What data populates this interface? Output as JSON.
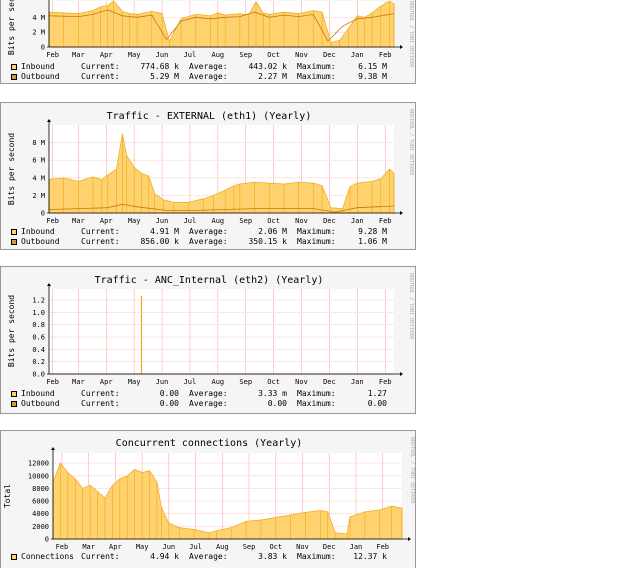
{
  "colors": {
    "inbound_fill": "#ffd270",
    "inbound_line": "#f0a818",
    "outbound_line": "#c87800",
    "outbound_sw": "#d89a28",
    "grid": "#ffaaaa",
    "bg": "#f5f5f5"
  },
  "watermark": "RRDTOOL / TOBI OETIKER",
  "chart_data": [
    {
      "type": "area",
      "title": "",
      "ylabel": "Bits per second",
      "yticks": [
        {
          "v": 0,
          "label": "0"
        },
        {
          "v": 2,
          "label": "2 M"
        },
        {
          "v": 4,
          "label": "4 M"
        }
      ],
      "ylim": [
        0,
        6.2
      ],
      "x_categories": [
        "Feb",
        "Mar",
        "Apr",
        "May",
        "Jun",
        "Jul",
        "Aug",
        "Sep",
        "Oct",
        "Nov",
        "Dec",
        "Jan",
        "Feb"
      ],
      "x_positions": [
        0.25,
        2,
        3.9,
        5.8,
        7.7,
        9.6,
        11.5,
        13.4,
        15.3,
        17.2,
        19.1,
        21,
        22.9
      ],
      "xrange": [
        0,
        23.5
      ],
      "x_unit": "month index from start of period",
      "series": [
        {
          "name": "Inbound",
          "kind": "area",
          "points": [
            [
              0,
              4.7
            ],
            [
              1,
              4.6
            ],
            [
              2,
              4.5
            ],
            [
              3,
              4.9
            ],
            [
              3.5,
              5.4
            ],
            [
              4,
              5.6
            ],
            [
              4.4,
              6.2
            ],
            [
              5,
              4.8
            ],
            [
              5.5,
              4.5
            ],
            [
              6,
              4.4
            ],
            [
              7,
              4.8
            ],
            [
              7.7,
              4.5
            ],
            [
              8.2,
              0.8
            ],
            [
              9,
              3.8
            ],
            [
              10,
              4.4
            ],
            [
              11,
              4.2
            ],
            [
              11.5,
              4.6
            ],
            [
              12,
              4.3
            ],
            [
              13,
              4.5
            ],
            [
              13.6,
              4.3
            ],
            [
              14.1,
              6.1
            ],
            [
              14.6,
              4.6
            ],
            [
              15,
              4.4
            ],
            [
              16,
              4.7
            ],
            [
              17,
              4.5
            ],
            [
              18,
              4.9
            ],
            [
              18.6,
              4.7
            ],
            [
              19.2,
              0.6
            ],
            [
              19.8,
              0.9
            ],
            [
              20.4,
              2.5
            ],
            [
              21,
              4.2
            ],
            [
              21.5,
              4.0
            ],
            [
              22,
              4.6
            ],
            [
              22.6,
              5.5
            ],
            [
              23.2,
              6.2
            ],
            [
              23.5,
              5.8
            ]
          ]
        },
        {
          "name": "Outbound",
          "kind": "line",
          "points": [
            [
              0,
              4.2
            ],
            [
              2,
              4.1
            ],
            [
              3,
              4.4
            ],
            [
              4,
              5.0
            ],
            [
              5,
              4.2
            ],
            [
              6,
              4.0
            ],
            [
              7,
              4.3
            ],
            [
              8,
              1.0
            ],
            [
              9,
              3.5
            ],
            [
              10,
              4.0
            ],
            [
              11,
              3.8
            ],
            [
              12,
              4.0
            ],
            [
              13,
              4.1
            ],
            [
              14,
              4.7
            ],
            [
              15,
              4.0
            ],
            [
              16,
              4.3
            ],
            [
              17,
              4.1
            ],
            [
              18,
              4.4
            ],
            [
              19,
              0.8
            ],
            [
              20,
              2.8
            ],
            [
              21,
              3.8
            ],
            [
              22,
              4.0
            ],
            [
              23.5,
              4.5
            ]
          ]
        }
      ],
      "legend": [
        {
          "name": "Inbound",
          "current": "774.68 k",
          "average": "443.02 k",
          "maximum": "6.15 M"
        },
        {
          "name": "Outbound",
          "current": "5.29 M",
          "average": "2.27 M",
          "maximum": "9.38 M"
        }
      ]
    },
    {
      "type": "area",
      "title": "Traffic - EXTERNAL (eth1) (Yearly)",
      "ylabel": "Bits per second",
      "yticks": [
        {
          "v": 0,
          "label": "0"
        },
        {
          "v": 2,
          "label": "2 M"
        },
        {
          "v": 4,
          "label": "4 M"
        },
        {
          "v": 6,
          "label": "6 M"
        },
        {
          "v": 8,
          "label": "8 M"
        }
      ],
      "ylim": [
        0,
        10
      ],
      "x_categories": [
        "Feb",
        "Mar",
        "Apr",
        "May",
        "Jun",
        "Jul",
        "Aug",
        "Sep",
        "Oct",
        "Nov",
        "Dec",
        "Jan",
        "Feb"
      ],
      "x_positions": [
        0.25,
        2,
        3.9,
        5.8,
        7.7,
        9.6,
        11.5,
        13.4,
        15.3,
        17.2,
        19.1,
        21,
        22.9
      ],
      "xrange": [
        0,
        23.5
      ],
      "x_unit": "month index from start of period",
      "series": [
        {
          "name": "Inbound",
          "kind": "area",
          "points": [
            [
              0,
              3.8
            ],
            [
              1,
              4.0
            ],
            [
              2,
              3.6
            ],
            [
              3,
              4.1
            ],
            [
              3.6,
              3.8
            ],
            [
              4,
              4.3
            ],
            [
              4.6,
              5.0
            ],
            [
              5,
              9.0
            ],
            [
              5.3,
              6.5
            ],
            [
              5.8,
              5.2
            ],
            [
              6.3,
              4.5
            ],
            [
              6.8,
              4.2
            ],
            [
              7.2,
              2.2
            ],
            [
              7.8,
              1.5
            ],
            [
              8.5,
              1.2
            ],
            [
              9.5,
              1.2
            ],
            [
              10.5,
              1.6
            ],
            [
              11.2,
              2.0
            ],
            [
              12,
              2.6
            ],
            [
              12.6,
              3.1
            ],
            [
              13,
              3.3
            ],
            [
              14,
              3.5
            ],
            [
              15,
              3.4
            ],
            [
              16,
              3.3
            ],
            [
              17,
              3.5
            ],
            [
              18,
              3.4
            ],
            [
              18.6,
              3.1
            ],
            [
              19.2,
              0.6
            ],
            [
              20,
              0.5
            ],
            [
              20.5,
              3.0
            ],
            [
              21,
              3.4
            ],
            [
              22,
              3.6
            ],
            [
              22.6,
              3.9
            ],
            [
              23.2,
              5.0
            ],
            [
              23.5,
              4.5
            ]
          ]
        },
        {
          "name": "Outbound",
          "kind": "line",
          "points": [
            [
              0,
              0.4
            ],
            [
              2,
              0.5
            ],
            [
              4,
              0.6
            ],
            [
              5,
              1.0
            ],
            [
              6,
              0.7
            ],
            [
              8,
              0.3
            ],
            [
              10,
              0.3
            ],
            [
              12,
              0.4
            ],
            [
              14,
              0.5
            ],
            [
              16,
              0.5
            ],
            [
              18,
              0.5
            ],
            [
              19.5,
              0.1
            ],
            [
              21,
              0.6
            ],
            [
              23.5,
              0.8
            ]
          ]
        }
      ],
      "legend": [
        {
          "name": "Inbound",
          "current": "4.91 M",
          "average": "2.06 M",
          "maximum": "9.28 M"
        },
        {
          "name": "Outbound",
          "current": "856.00 k",
          "average": "350.15 k",
          "maximum": "1.06 M"
        }
      ]
    },
    {
      "type": "area",
      "title": "Traffic - ANC_Internal (eth2) (Yearly)",
      "ylabel": "Bits per second",
      "yticks": [
        {
          "v": 0,
          "label": "0.0"
        },
        {
          "v": 0.2,
          "label": "0.2"
        },
        {
          "v": 0.4,
          "label": "0.4"
        },
        {
          "v": 0.6,
          "label": "0.6"
        },
        {
          "v": 0.8,
          "label": "0.8"
        },
        {
          "v": 1.0,
          "label": "1.0"
        },
        {
          "v": 1.2,
          "label": "1.2"
        }
      ],
      "ylim": [
        0,
        1.38
      ],
      "x_categories": [
        "Feb",
        "Mar",
        "Apr",
        "May",
        "Jun",
        "Jul",
        "Aug",
        "Sep",
        "Oct",
        "Nov",
        "Dec",
        "Jan",
        "Feb"
      ],
      "x_positions": [
        0.25,
        2,
        3.9,
        5.8,
        7.7,
        9.6,
        11.5,
        13.4,
        15.3,
        17.2,
        19.1,
        21,
        22.9
      ],
      "xrange": [
        0,
        23.5
      ],
      "x_unit": "month index from start of period",
      "series": [
        {
          "name": "Inbound",
          "kind": "spike",
          "points": [
            [
              6.3,
              1.27
            ]
          ]
        },
        {
          "name": "Outbound",
          "kind": "line",
          "points": [
            [
              0,
              0
            ],
            [
              23.5,
              0
            ]
          ]
        }
      ],
      "legend": [
        {
          "name": "Inbound",
          "current": "0.00",
          "average": "3.33 m",
          "maximum": "1.27"
        },
        {
          "name": "Outbound",
          "current": "0.00",
          "average": "0.00",
          "maximum": "0.00"
        }
      ]
    },
    {
      "type": "area",
      "title": "Concurrent connections (Yearly)",
      "ylabel": "Total",
      "yticks": [
        {
          "v": 0,
          "label": "0"
        },
        {
          "v": 2000,
          "label": "2000"
        },
        {
          "v": 4000,
          "label": "4000"
        },
        {
          "v": 6000,
          "label": "6000"
        },
        {
          "v": 8000,
          "label": "8000"
        },
        {
          "v": 10000,
          "label": "10000"
        },
        {
          "v": 12000,
          "label": "12000"
        }
      ],
      "ylim": [
        0,
        13600
      ],
      "x_categories": [
        "Feb",
        "Mar",
        "Apr",
        "May",
        "Jun",
        "Jul",
        "Aug",
        "Sep",
        "Oct",
        "Nov",
        "Dec",
        "Jan",
        "Feb"
      ],
      "x_positions": [
        0.6,
        2.4,
        4.2,
        6.0,
        7.8,
        9.6,
        11.4,
        13.2,
        15.0,
        16.8,
        18.6,
        20.4,
        22.2
      ],
      "xrange": [
        0,
        23.5
      ],
      "x_unit": "month index from start of period",
      "series": [
        {
          "name": "Connections",
          "kind": "area",
          "points": [
            [
              0,
              9000
            ],
            [
              0.5,
              12000
            ],
            [
              1,
              10500
            ],
            [
              1.5,
              9500
            ],
            [
              2,
              8000
            ],
            [
              2.5,
              8500
            ],
            [
              3,
              7500
            ],
            [
              3.5,
              6500
            ],
            [
              4,
              8500
            ],
            [
              4.5,
              9500
            ],
            [
              5,
              10000
            ],
            [
              5.5,
              11000
            ],
            [
              6,
              10500
            ],
            [
              6.5,
              10800
            ],
            [
              7,
              9000
            ],
            [
              7.3,
              5000
            ],
            [
              7.8,
              2500
            ],
            [
              8.5,
              1800
            ],
            [
              9.5,
              1500
            ],
            [
              10.5,
              1000
            ],
            [
              11,
              1300
            ],
            [
              12,
              1800
            ],
            [
              13,
              2800
            ],
            [
              14,
              3000
            ],
            [
              15,
              3400
            ],
            [
              16,
              3800
            ],
            [
              17,
              4200
            ],
            [
              18,
              4500
            ],
            [
              18.5,
              4300
            ],
            [
              19,
              1000
            ],
            [
              19.8,
              800
            ],
            [
              20,
              3500
            ],
            [
              21,
              4300
            ],
            [
              22,
              4600
            ],
            [
              22.8,
              5200
            ],
            [
              23.5,
              4900
            ]
          ]
        }
      ],
      "legend": [
        {
          "name": "Connections",
          "current": "4.94 k",
          "average": "3.83 k",
          "maximum": "12.37 k"
        }
      ]
    }
  ]
}
